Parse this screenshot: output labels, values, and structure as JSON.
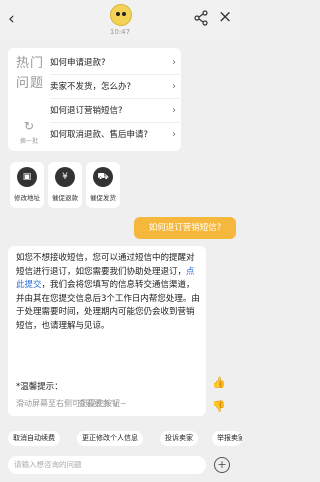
{
  "header": {
    "time": "10:47"
  },
  "hot": {
    "title": "热门问题",
    "refresh_label": "换一批",
    "questions": [
      "如何申请退款?",
      "卖家不发货，怎么办?",
      "如何退订营销短信?",
      "如何取消退款、售后申请?"
    ]
  },
  "shortcuts": [
    {
      "label": "修改地址",
      "icon": "address-card-icon"
    },
    {
      "label": "催促退款",
      "icon": "refund-coin-icon"
    },
    {
      "label": "催促发货",
      "icon": "delivery-truck-icon"
    }
  ],
  "user_message": "如何退订营销短信?",
  "answer": {
    "text_before": "如您不想接收短信，您可以通过短信中的提醒对短信进行退订，如您需要我们协助处理退订，",
    "link": "点此提交",
    "text_after": "，我们会将您填写的信息转交通信渠道，并由其在您提交信息后3个工作日内帮您处理。由于处理需要时间，处理期内可能您仍会收到营销短信，也请理解与见谅。",
    "tip_title": "*温馨提示：",
    "tip_text": "滑动屏幕至右侧可见提交按钮~",
    "more_label": "查看更多 ∨"
  },
  "quick_chips": [
    "取消自动续费",
    "更正修改个人信息",
    "投诉卖家",
    "举报卖家"
  ],
  "input": {
    "placeholder": "请输入想咨询的问题"
  }
}
